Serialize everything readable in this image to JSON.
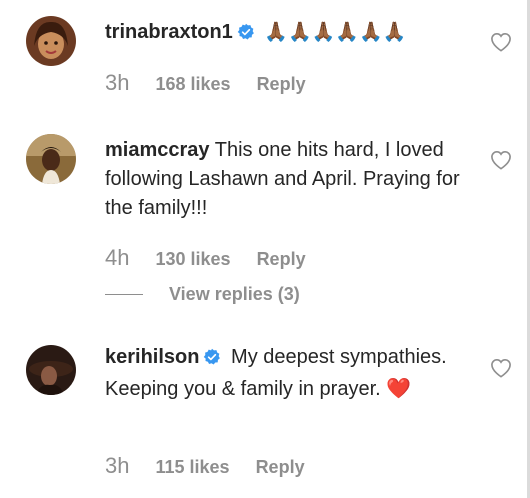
{
  "comments": [
    {
      "username": "trinabraxton1",
      "verified": true,
      "text": "🙏🏾🙏🏾🙏🏾🙏🏾🙏🏾🙏🏾",
      "time": "3h",
      "likes": "168 likes",
      "reply": "Reply"
    },
    {
      "username": "miamccray",
      "verified": false,
      "text": "This one hits hard, I loved following Lashawn and April. Praying for the family!!!",
      "time": "4h",
      "likes": "130 likes",
      "reply": "Reply",
      "view_replies": "View replies (3)"
    },
    {
      "username": "kerihilson",
      "verified": true,
      "text": "My deepest sympathies. Keeping you & family in prayer.",
      "emoji": "❤️",
      "time": "3h",
      "likes": "115 likes",
      "reply": "Reply"
    }
  ],
  "icons": {
    "like": "heart-outline-icon",
    "verified": "verified-badge-icon"
  },
  "colors": {
    "text": "#262626",
    "muted": "#8e8e8e",
    "verified": "#3897f0",
    "emoji_heart": "#e0245e"
  }
}
